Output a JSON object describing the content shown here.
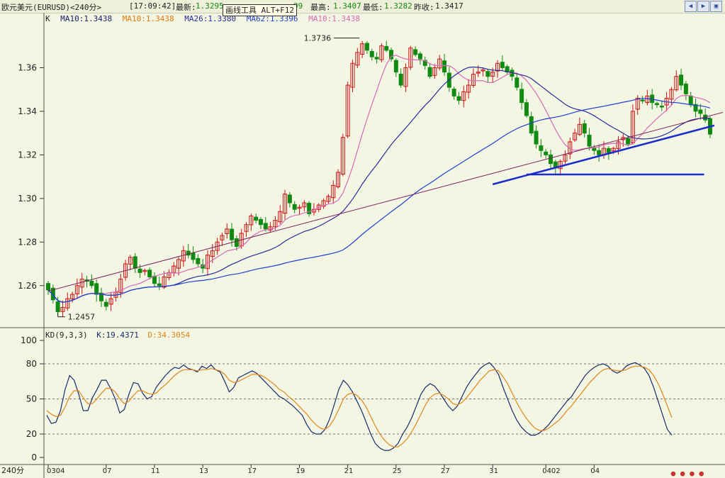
{
  "header": {
    "symbol": "欧元美元(EURUSD)<240分>",
    "time": "[17:09:42]",
    "latest_label": "最新:",
    "latest": "1.3295",
    "change_tail": "99",
    "high_label": "最高:",
    "high": "1.3407",
    "low_label": "最低:",
    "low": "1.3282",
    "prevclose_label": "昨收:",
    "prevclose": "1.3417",
    "tooltip": "画线工具 ALT+F12"
  },
  "legend": {
    "k": "K",
    "ma10a": "MA10:1.3438",
    "ma10b": "MA10:1.3438",
    "ma26": "MA26:1.3380",
    "ma62": "MA62:1.3396",
    "ma_extra": "MA10:1.3438"
  },
  "kd_legend": {
    "name": "KD(9,3,3)",
    "k": "K:19.4371",
    "d": "D:34.3054"
  },
  "period_label": "240分",
  "colors": {
    "up": "#cc1111",
    "down": "#118a11",
    "ma10": "#d46ab8",
    "ma26": "#2a2a9a",
    "ma62": "#1f3fd0",
    "trend_long": "#7a1f5a",
    "trend_blue": "#1a2ccc",
    "kd_k": "#1a2a6a",
    "kd_d": "#e0851a",
    "grid": "#777777"
  },
  "chart_data": [
    {
      "type": "candlestick",
      "title": "欧元美元(EURUSD) 240分",
      "ylim": [
        1.243,
        1.38
      ],
      "y_ticks": [
        1.26,
        1.28,
        1.3,
        1.32,
        1.34,
        1.36
      ],
      "x_tick_labels": [
        "0304",
        "07",
        "11",
        "13",
        "17",
        "19",
        "21",
        "25",
        "27",
        "31",
        "0402",
        "04"
      ],
      "annotations": [
        {
          "text": "1.3736",
          "kind": "high"
        },
        {
          "text": "1.2457",
          "kind": "low"
        }
      ],
      "close": [
        1.258,
        1.2535,
        1.248,
        1.25,
        1.254,
        1.256,
        1.26,
        1.263,
        1.262,
        1.26,
        1.256,
        1.253,
        1.2505,
        1.254,
        1.257,
        1.263,
        1.27,
        1.273,
        1.268,
        1.266,
        1.267,
        1.264,
        1.261,
        1.26,
        1.264,
        1.266,
        1.269,
        1.272,
        1.276,
        1.274,
        1.272,
        1.27,
        1.268,
        1.274,
        1.276,
        1.28,
        1.283,
        1.286,
        1.281,
        1.278,
        1.284,
        1.288,
        1.292,
        1.29,
        1.288,
        1.286,
        1.287,
        1.29,
        1.294,
        1.302,
        1.298,
        1.295,
        1.296,
        1.298,
        1.293,
        1.295,
        1.297,
        1.299,
        1.301,
        1.306,
        1.312,
        1.328,
        1.352,
        1.362,
        1.367,
        1.371,
        1.368,
        1.365,
        1.364,
        1.37,
        1.368,
        1.364,
        1.358,
        1.352,
        1.36,
        1.369,
        1.366,
        1.364,
        1.361,
        1.356,
        1.36,
        1.364,
        1.358,
        1.351,
        1.347,
        1.345,
        1.349,
        1.352,
        1.357,
        1.358,
        1.359,
        1.356,
        1.358,
        1.362,
        1.36,
        1.358,
        1.356,
        1.351,
        1.344,
        1.338,
        1.33,
        1.325,
        1.322,
        1.32,
        1.316,
        1.314,
        1.317,
        1.32,
        1.326,
        1.33,
        1.334,
        1.33,
        1.324,
        1.322,
        1.32,
        1.323,
        1.321,
        1.323,
        1.326,
        1.328,
        1.325,
        1.34,
        1.346,
        1.345,
        1.347,
        1.344,
        1.343,
        1.342,
        1.346,
        1.35,
        1.356,
        1.352,
        1.348,
        1.343,
        1.34,
        1.339,
        1.336,
        1.3295
      ],
      "ma10_end": 1.3438,
      "ma26_end": 1.338,
      "ma62_end": 1.3396
    },
    {
      "type": "line",
      "name": "KD(9,3,3)",
      "ylim": [
        0,
        100
      ],
      "y_ticks": [
        0,
        20,
        50,
        80,
        100
      ],
      "series": [
        {
          "name": "K",
          "values": [
            36,
            29,
            30,
            40,
            58,
            70,
            66,
            54,
            40,
            40,
            51,
            58,
            66,
            66,
            59,
            50,
            38,
            41,
            54,
            64,
            63,
            55,
            50,
            52,
            60,
            65,
            70,
            74,
            77,
            76,
            79,
            76,
            75,
            73,
            78,
            76,
            79,
            75,
            73,
            65,
            56,
            60,
            68,
            70,
            72,
            74,
            72,
            68,
            64,
            60,
            56,
            52,
            50,
            47,
            44,
            40,
            36,
            28,
            22,
            20,
            20,
            24,
            33,
            45,
            58,
            66,
            62,
            56,
            48,
            40,
            30,
            20,
            12,
            8,
            6,
            6,
            8,
            12,
            20,
            26,
            34,
            44,
            54,
            60,
            63,
            61,
            56,
            50,
            44,
            40,
            44,
            52,
            60,
            66,
            71,
            76,
            79,
            81,
            77,
            71,
            60,
            50,
            40,
            32,
            26,
            22,
            19,
            19,
            21,
            24,
            28,
            33,
            38,
            43,
            48,
            52,
            58,
            64,
            70,
            74,
            77,
            79,
            80,
            78,
            74,
            72,
            74,
            78,
            80,
            81,
            79,
            76,
            70,
            60,
            48,
            36,
            24,
            19
          ]
        },
        {
          "name": "D",
          "values": [
            40,
            37,
            35,
            36,
            43,
            52,
            57,
            57,
            51,
            46,
            46,
            50,
            55,
            59,
            59,
            56,
            50,
            46,
            48,
            53,
            57,
            57,
            55,
            54,
            55,
            59,
            62,
            66,
            70,
            73,
            75,
            75,
            75,
            74,
            75,
            75,
            76,
            75,
            74,
            71,
            66,
            64,
            65,
            67,
            69,
            71,
            71,
            70,
            68,
            65,
            62,
            58,
            56,
            52,
            49,
            45,
            41,
            37,
            32,
            28,
            25,
            24,
            27,
            33,
            41,
            50,
            54,
            55,
            53,
            49,
            43,
            35,
            27,
            20,
            15,
            11,
            9,
            9,
            12,
            16,
            22,
            29,
            37,
            45,
            51,
            54,
            55,
            53,
            50,
            46,
            45,
            47,
            51,
            56,
            61,
            66,
            70,
            74,
            75,
            74,
            69,
            63,
            55,
            47,
            40,
            34,
            29,
            25,
            23,
            23,
            25,
            28,
            31,
            35,
            40,
            44,
            49,
            54,
            59,
            64,
            68,
            72,
            75,
            76,
            75,
            74,
            74,
            75,
            77,
            78,
            78,
            77,
            75,
            70,
            63,
            54,
            44,
            34
          ]
        }
      ]
    }
  ]
}
